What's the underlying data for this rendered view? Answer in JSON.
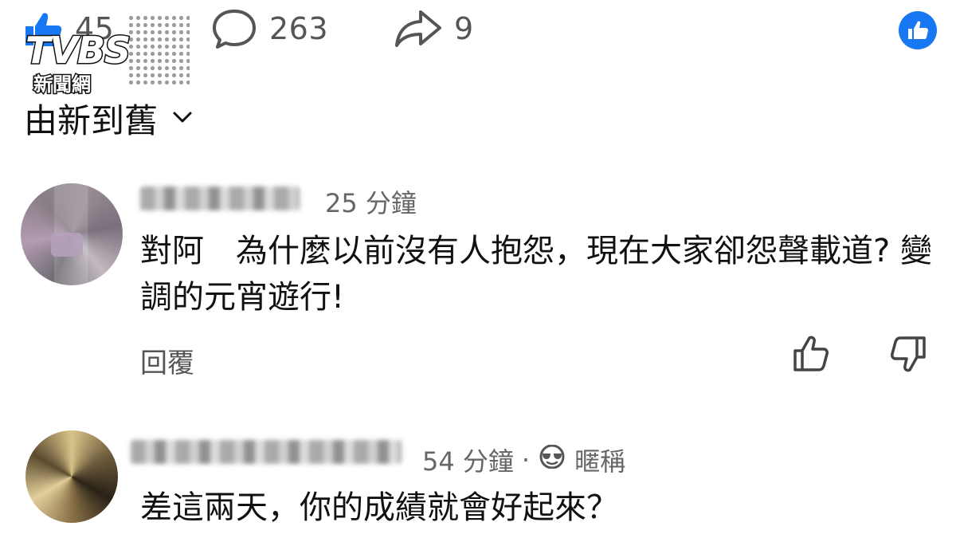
{
  "stats": {
    "likes": "45",
    "comments": "263",
    "shares": "9"
  },
  "icons": {
    "like": "thumbs-up-icon",
    "comment": "comment-bubble-icon",
    "share": "share-arrow-icon",
    "fb_like": "facebook-like-icon",
    "upvote": "thumbs-up-outline-icon",
    "downvote": "thumbs-down-outline-icon",
    "sunglasses": "sunglasses-icon"
  },
  "watermark": {
    "brand": "TVBS",
    "sub": "新聞網"
  },
  "sort": {
    "label": "由新到舊"
  },
  "comments": [
    {
      "time": "25 分鐘",
      "text": "對阿　為什麼以前沒有人抱怨，現在大家卻怨聲載道? 變調的元宵遊行!",
      "reply_label": "回覆"
    },
    {
      "time": "54 分鐘",
      "separator": "·",
      "nickname_label": "暱稱",
      "text": "差這兩天，你的成績就會好起來？"
    }
  ],
  "colors": {
    "fb_blue": "#1877f2",
    "muted_text": "#666666",
    "body_text": "#111111"
  }
}
